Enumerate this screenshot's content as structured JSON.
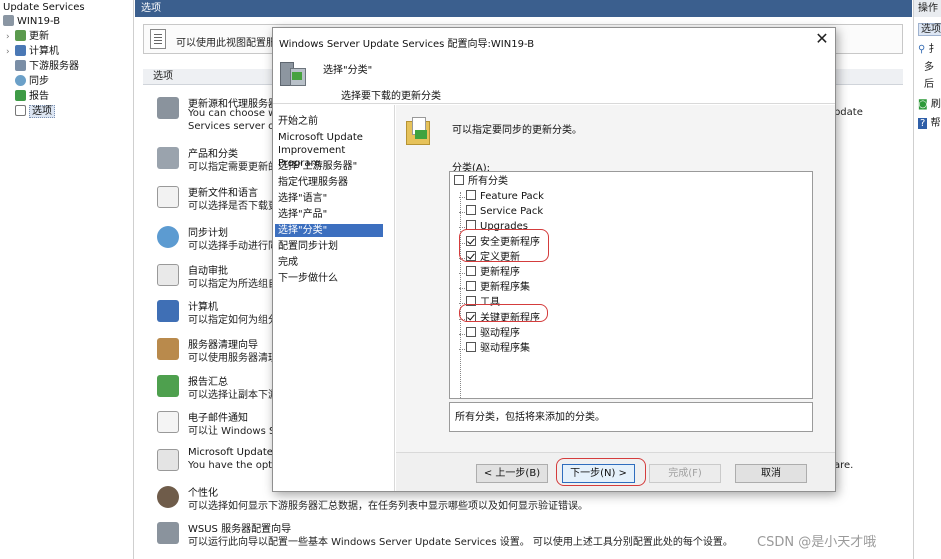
{
  "tree": {
    "root": "Update Services",
    "server": "WIN19-B",
    "items": [
      "更新",
      "计算机",
      "下游服务器",
      "同步",
      "报告",
      "选项"
    ]
  },
  "center": {
    "header": "选项",
    "info_text": "可以使用此视图配置服务",
    "options_header": "选项",
    "options": [
      {
        "title": "更新源和代理服务器",
        "desc": "You can choose wh",
        "desc2": "Services server on"
      },
      {
        "title": "产品和分类",
        "desc": "可以指定需要更新的产"
      },
      {
        "title": "更新文件和语言",
        "desc": "可以选择是否下载更"
      },
      {
        "title": "同步计划",
        "desc": "可以选择手动进行同步"
      },
      {
        "title": "自动审批",
        "desc": "可以指定为所选组自"
      },
      {
        "title": "计算机",
        "desc": "可以指定如何为组分"
      },
      {
        "title": "服务器清理向导",
        "desc": "可以使用服务器清理"
      },
      {
        "title": "报告汇总",
        "desc": "可以选择让副本下游"
      },
      {
        "title": "电子邮件通知",
        "desc": "可以让 Windows Se"
      },
      {
        "title": "Microsoft Update I",
        "desc": "You have the optio"
      },
      {
        "title": "个性化",
        "desc": "可以选择如何显示下游服务器汇总数据，在任务列表中显示哪些项以及如何显示验证错误。"
      },
      {
        "title": "WSUS 服务器配置向导",
        "desc": "可以运行此向导以配置一些基本 Windows Server Update Services 设置。 可以使用上述工具分别配置此处的每个设置。"
      }
    ],
    "right_fragment_1": "Jpdate",
    "right_fragment_2": "are."
  },
  "actions": {
    "header": "操作",
    "selected": "选项",
    "rows": [
      "扌",
      "多",
      "后",
      "刷",
      "帮"
    ]
  },
  "dialog": {
    "title": "Windows Server Update Services 配置向导:WIN19-B",
    "close_glyph": "✕",
    "header_title": "选择\"分类\"",
    "header_subtitle": "选择要下载的更新分类",
    "nav": [
      "开始之前",
      "Microsoft Update Improvement Program",
      "选择\"上游服务器\"",
      "指定代理服务器",
      "选择\"语言\"",
      "选择\"产品\"",
      "选择\"分类\"",
      "配置同步计划",
      "完成",
      "下一步做什么"
    ],
    "active_nav_index": 6,
    "content_desc": "可以指定要同步的更新分类。",
    "classifications_label": "分类(A):",
    "all_label": "所有分类",
    "classifications": [
      {
        "label": "Feature Pack",
        "checked": false
      },
      {
        "label": "Service Pack",
        "checked": false
      },
      {
        "label": "Upgrades",
        "checked": false
      },
      {
        "label": "安全更新程序",
        "checked": true
      },
      {
        "label": "定义更新",
        "checked": true
      },
      {
        "label": "更新程序",
        "checked": false
      },
      {
        "label": "更新程序集",
        "checked": false
      },
      {
        "label": "工具",
        "checked": false
      },
      {
        "label": "关键更新程序",
        "checked": true
      },
      {
        "label": "驱动程序",
        "checked": false
      },
      {
        "label": "驱动程序集",
        "checked": false
      }
    ],
    "status_text": "所有分类，包括将来添加的分类。",
    "buttons": {
      "back": "< 上一步(B)",
      "next": "下一步(N) >",
      "finish": "完成(F)",
      "cancel": "取消"
    }
  },
  "watermark": "CSDN @是小天才哦"
}
